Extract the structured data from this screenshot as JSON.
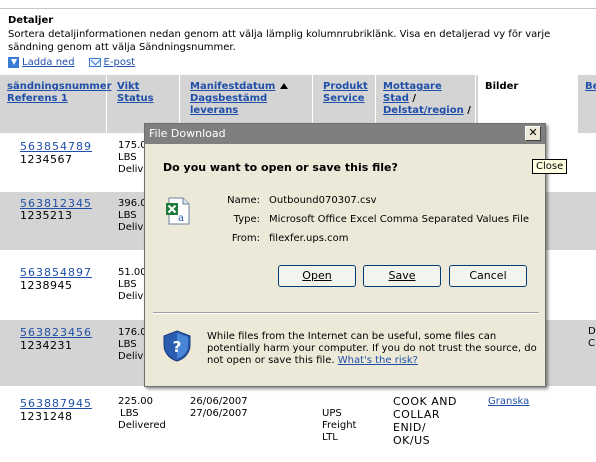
{
  "section": {
    "title": "Detaljer",
    "description": "Sortera detaljinformationen nedan genom att välja lämplig kolumnrubriklänk. Visa en detaljerad vy för varje sändning genom att välja Sändningsnummer."
  },
  "links": {
    "download": "Ladda ned",
    "email": "E-post"
  },
  "columns": {
    "col1_line1": "sändningsnummer",
    "col1_line2": "Referens 1",
    "col2_line1": "Vikt",
    "col2_line2": "Status",
    "col3_line1": "Manifestdatum",
    "col3_line2": "Dagsbestämd leverans",
    "col4_line1": "Produkt",
    "col4_line2": "Service",
    "col5_line1": "Mottagare",
    "col5_line2": "Stad",
    "col5_line3": "Delstat/region",
    "col5_sep": "/",
    "col6": "Bilder",
    "col7": "Be"
  },
  "rows": [
    {
      "tracking": "563854789",
      "ref": "1234567",
      "weight": "175.0",
      "unit": "LBS",
      "status": "Delivered"
    },
    {
      "tracking": "563812345",
      "ref": "1235213",
      "weight": "396.0",
      "unit": "LBS",
      "status": "Delivered"
    },
    {
      "tracking": "563854897",
      "ref": "1238945",
      "weight": "51.00",
      "unit": "LBS",
      "status": "Delivered"
    },
    {
      "tracking": "563823456",
      "ref": "1234231",
      "weight": "176.0",
      "unit": "LBS",
      "status": "Delivered",
      "extra1": "D",
      "extra2": "C"
    },
    {
      "tracking": "563887945",
      "ref": "1231248",
      "weight": "225.00",
      "unit": "LBS",
      "status": "Delivered",
      "manifest": "26/06/2007",
      "delivery": "27/06/2007",
      "product1": "UPS",
      "product2": "Freight",
      "product3": "LTL",
      "recipient1": "COOK AND",
      "recipient2": "COLLAR",
      "recipient3": "ENID/",
      "recipient4": "OK/US",
      "image_link": "Granska"
    }
  ],
  "dialog": {
    "title": "File Download",
    "close_symbol": "✕",
    "question": "Do you want to open or save this file?",
    "name_label": "Name:",
    "name_value": "Outbound070307.csv",
    "type_label": "Type:",
    "type_value": "Microsoft Office Excel Comma Separated Values File",
    "from_label": "From:",
    "from_value": "filexfer.ups.com",
    "open_button": "Open",
    "save_button": "Save",
    "cancel_button": "Cancel",
    "warning_text": "While files from the Internet can be useful, some files can potentially harm your computer. If you do not trust the source, do not open or save this file.",
    "warning_link": "What's the risk?"
  },
  "tooltip": "Close",
  "colors": {
    "link": "#1f4fa8",
    "header_bg": "#d4d4d4",
    "dialog_bg": "#ece9d8",
    "titlebar_inactive": "#7f7f7f"
  }
}
